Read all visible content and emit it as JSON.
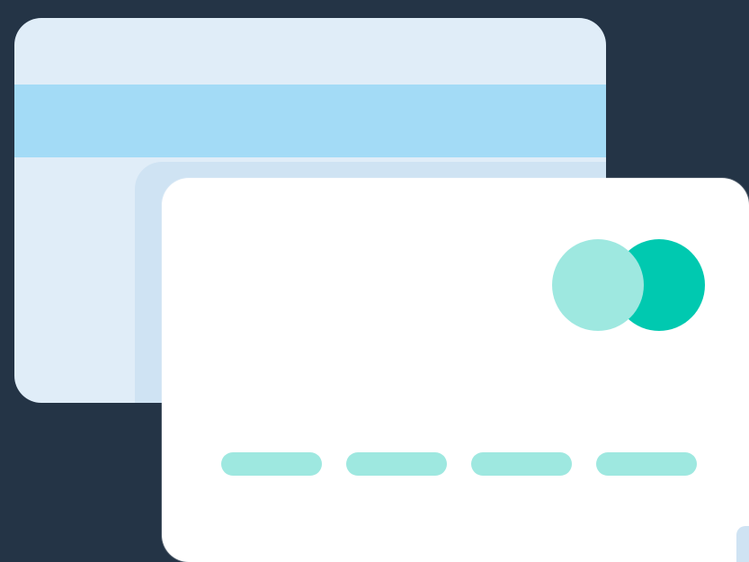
{
  "illustration": {
    "subject": "credit-cards",
    "colors": {
      "background": "#243446",
      "back_card": "#e0edf8",
      "magstripe": "#a3dbf6",
      "front_card": "#ffffff",
      "logo_left": "#9ee8e0",
      "logo_right": "#00c9b0",
      "number_groups": "#9ee8e0"
    },
    "number_group_count": 4
  }
}
